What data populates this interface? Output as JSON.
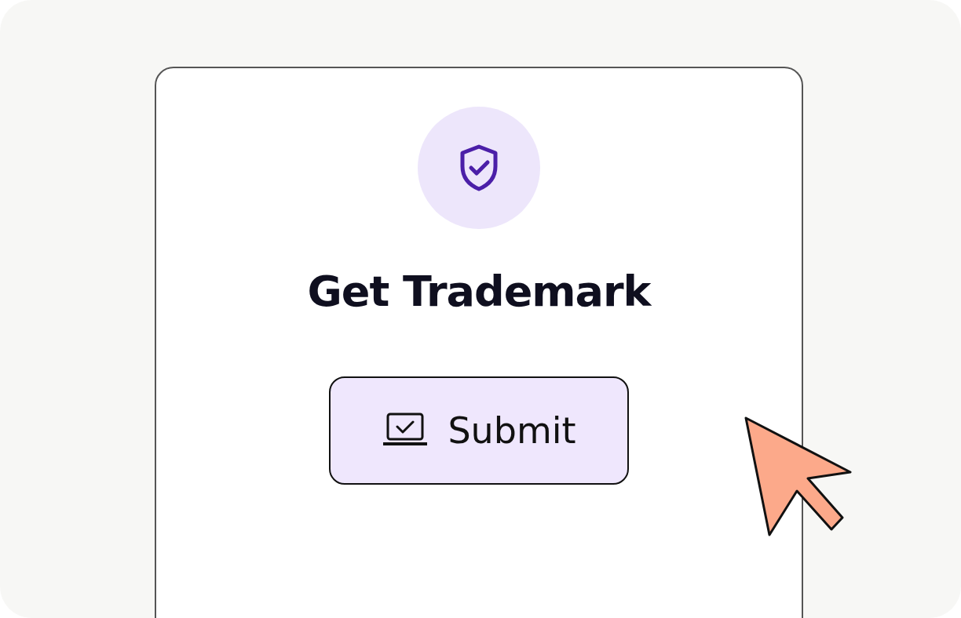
{
  "card": {
    "title": "Get Trademark",
    "button": {
      "label": "Submit"
    }
  }
}
